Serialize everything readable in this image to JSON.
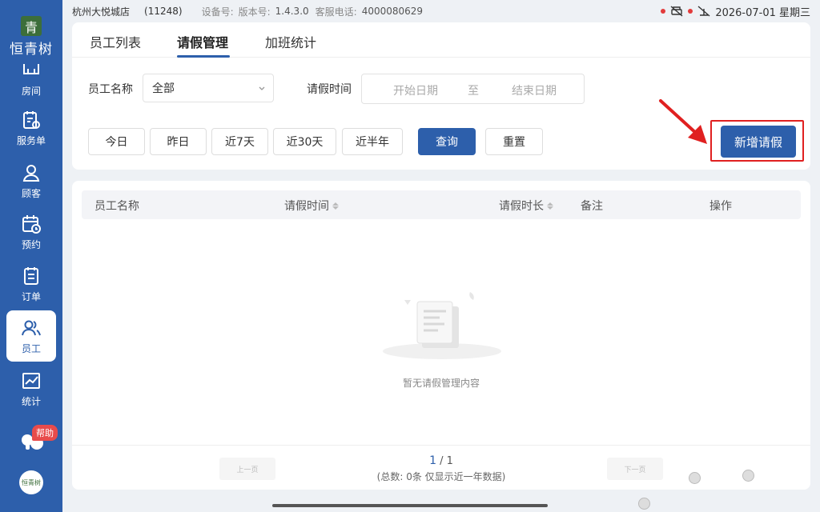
{
  "app": {
    "logo_mark": "青",
    "logo_text": "恒青树",
    "bottom_logo_text": "恒青树"
  },
  "statusbar": {
    "store_name": "杭州大悦城店",
    "store_code": "(11248)",
    "device_label": "设备号:",
    "version_label": "版本号:",
    "version_value": "1.4.3.0",
    "phone_label": "客服电话:",
    "phone_value": "4000080629",
    "datetime": "2026-07-01 星期三"
  },
  "sidebar": {
    "items": [
      {
        "label": "房间",
        "icon": "room-icon"
      },
      {
        "label": "服务单",
        "icon": "service-order-icon"
      },
      {
        "label": "顾客",
        "icon": "customer-icon"
      },
      {
        "label": "预约",
        "icon": "calendar-clock-icon"
      },
      {
        "label": "订单",
        "icon": "order-icon"
      },
      {
        "label": "员工",
        "icon": "staff-icon",
        "active": true
      },
      {
        "label": "统计",
        "icon": "chart-icon"
      }
    ],
    "help_badge": "帮助"
  },
  "tabs": [
    {
      "label": "员工列表"
    },
    {
      "label": "请假管理",
      "active": true
    },
    {
      "label": "加班统计"
    }
  ],
  "filters": {
    "employee_label": "员工名称",
    "employee_value": "全部",
    "leave_time_label": "请假时间",
    "start_placeholder": "开始日期",
    "range_sep": "至",
    "end_placeholder": "结束日期",
    "quick": [
      "今日",
      "昨日",
      "近7天",
      "近30天",
      "近半年"
    ],
    "query_btn": "查询",
    "reset_btn": "重置",
    "new_btn": "新增请假"
  },
  "table": {
    "columns": [
      "员工名称",
      "请假时间",
      "请假时长",
      "备注",
      "操作"
    ],
    "empty_text": "暂无请假管理内容"
  },
  "pager": {
    "prev": "上一页",
    "next": "下一页",
    "current": "1",
    "sep": " / ",
    "total_pages": "1",
    "summary": "(总数: 0条 仅显示近一年数据)"
  },
  "colors": {
    "brand": "#2d5fab",
    "highlight": "#e02020"
  }
}
